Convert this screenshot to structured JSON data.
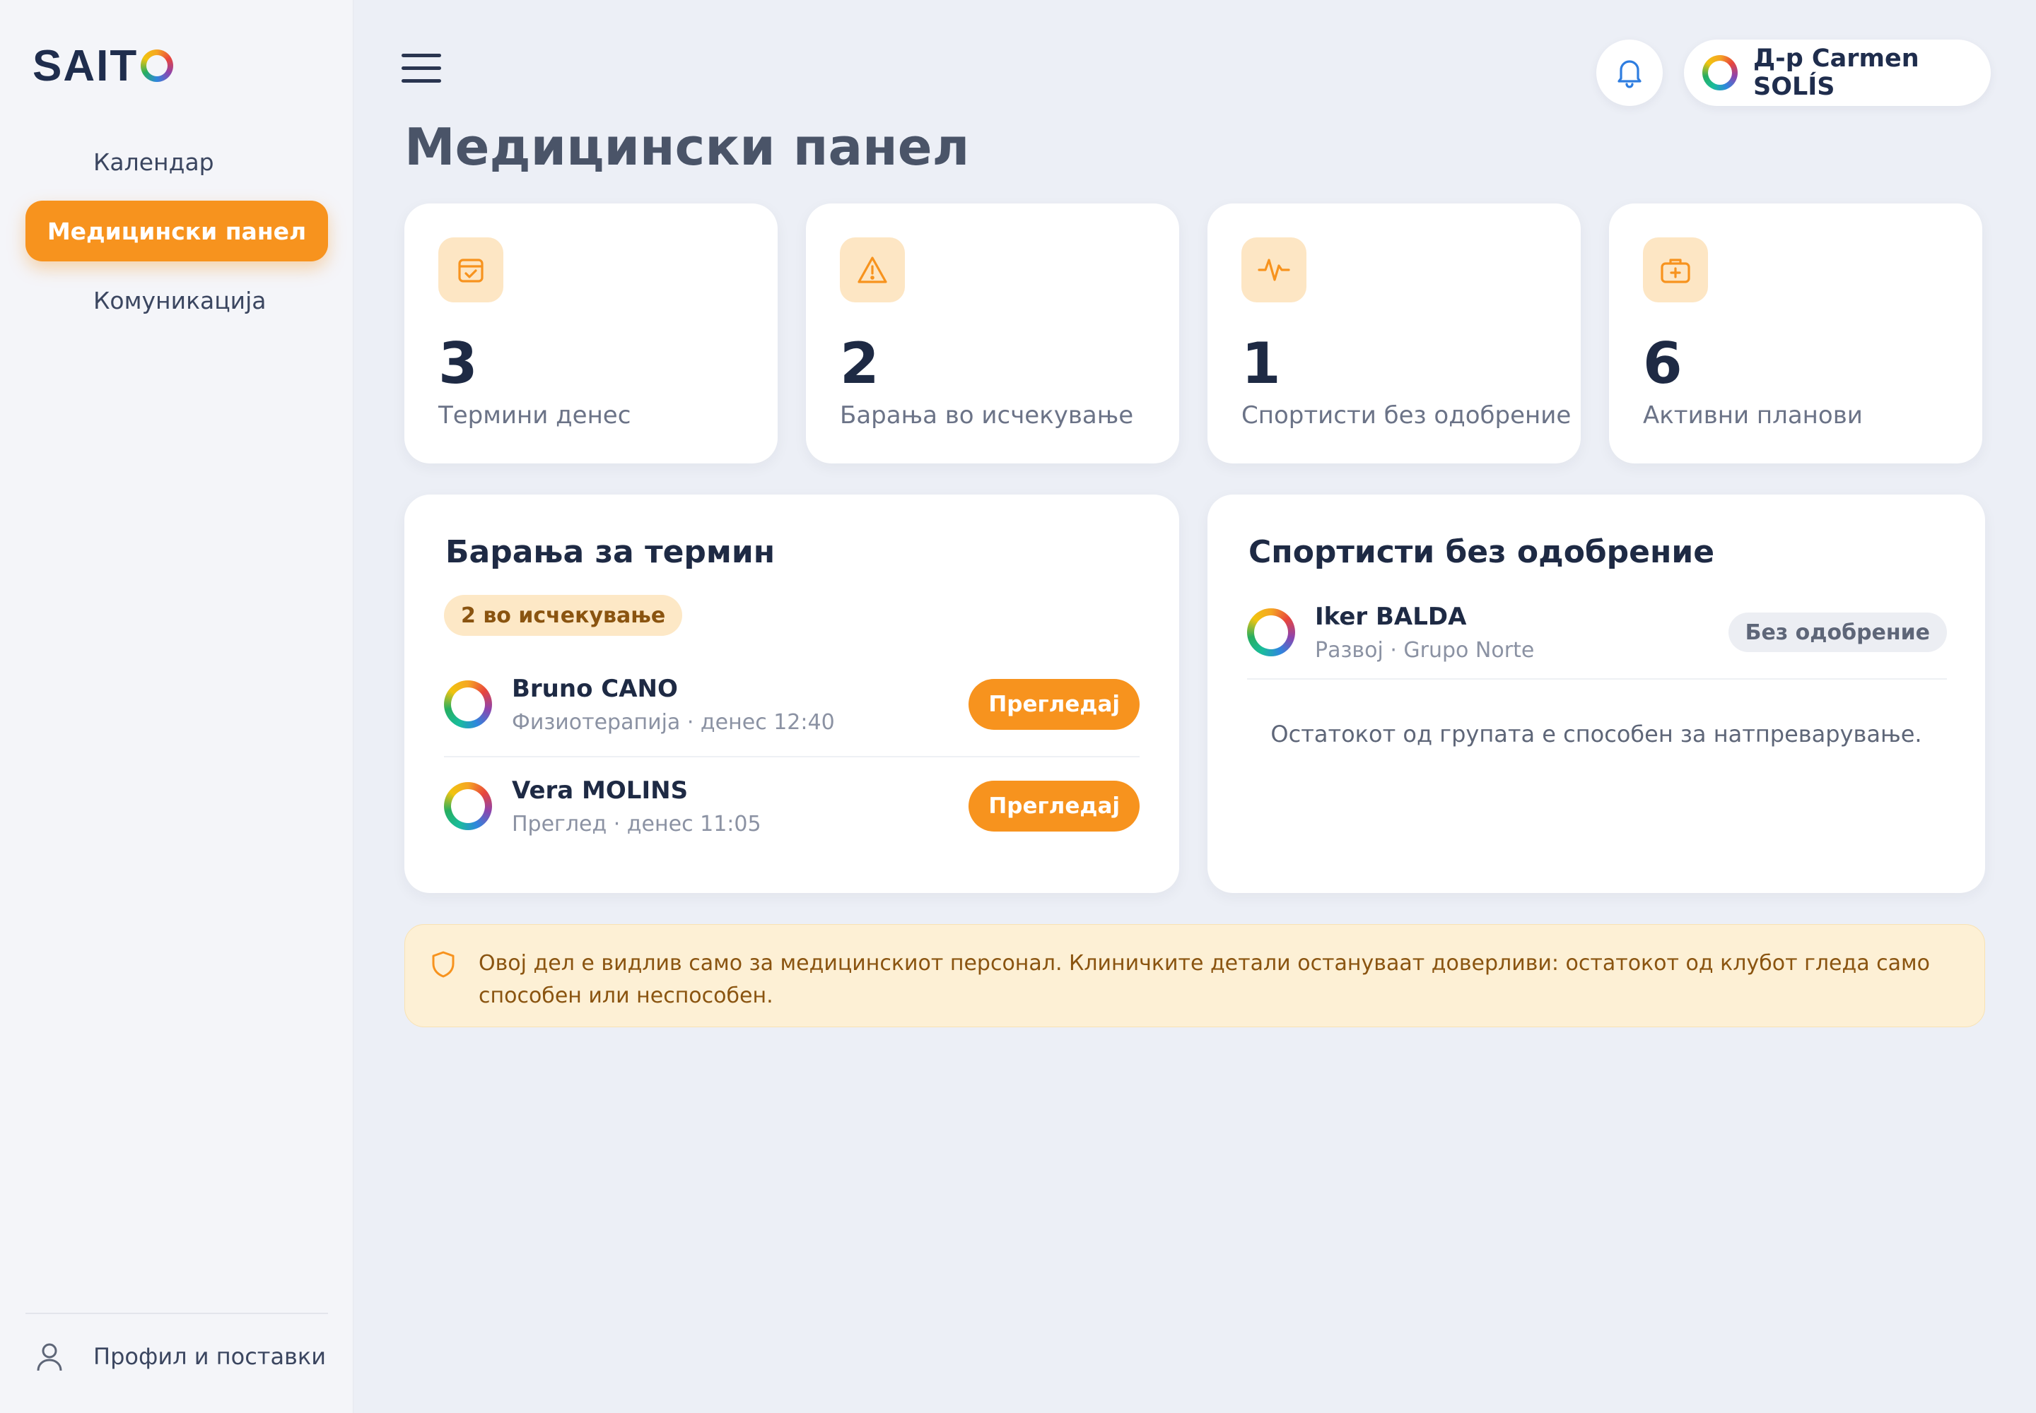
{
  "app": {
    "logo_text": "SAIT",
    "colors": {
      "accent": "#f7931e",
      "accent_soft": "#fde6c4",
      "text_dark": "#1e2a44",
      "background": "#eceff6"
    }
  },
  "sidebar": {
    "items": [
      {
        "label": "Календар",
        "active": false
      },
      {
        "label": "Медицински панел",
        "active": true
      },
      {
        "label": "Комуникација",
        "active": false
      }
    ],
    "footer_label": "Профил и поставки",
    "footer_icon": "user-icon"
  },
  "header": {
    "menu_icon": "hamburger-menu-icon",
    "bell_icon": "bell-icon",
    "user_name": "Д-р Carmen SOLÍS"
  },
  "page": {
    "title": "Медицински панел"
  },
  "stats": [
    {
      "value": "3",
      "label": "Термини денес",
      "icon": "calendar-check-icon"
    },
    {
      "value": "2",
      "label": "Барања во исчекување",
      "icon": "warning-triangle-icon"
    },
    {
      "value": "1",
      "label": "Спортисти без одобрение",
      "icon": "pulse-icon"
    },
    {
      "value": "6",
      "label": "Активни планови",
      "icon": "medical-kit-icon"
    }
  ],
  "requests": {
    "title": "Барања за термин",
    "badge": "2 во исчекување",
    "items": [
      {
        "name": "Bruno CANO",
        "detail": "Физиотерапија · денес 12:40",
        "action": "Прегледај"
      },
      {
        "name": "Vera MOLINS",
        "detail": "Преглед · денес 11:05",
        "action": "Прегледај"
      }
    ]
  },
  "unapproved": {
    "title": "Спортисти без одобрение",
    "items": [
      {
        "name": "Iker BALDA",
        "detail": "Развој · Grupo Norte",
        "status": "Без одобрение"
      }
    ],
    "note": "Остатокот од групата е способен за натпреварување."
  },
  "notice": {
    "icon": "shield-icon",
    "text": "Овој дел е видлив само за медицинскиот персонал. Клиничките детали остануваат доверливи: остатокот од клубот гледа само способен или неспособен."
  }
}
